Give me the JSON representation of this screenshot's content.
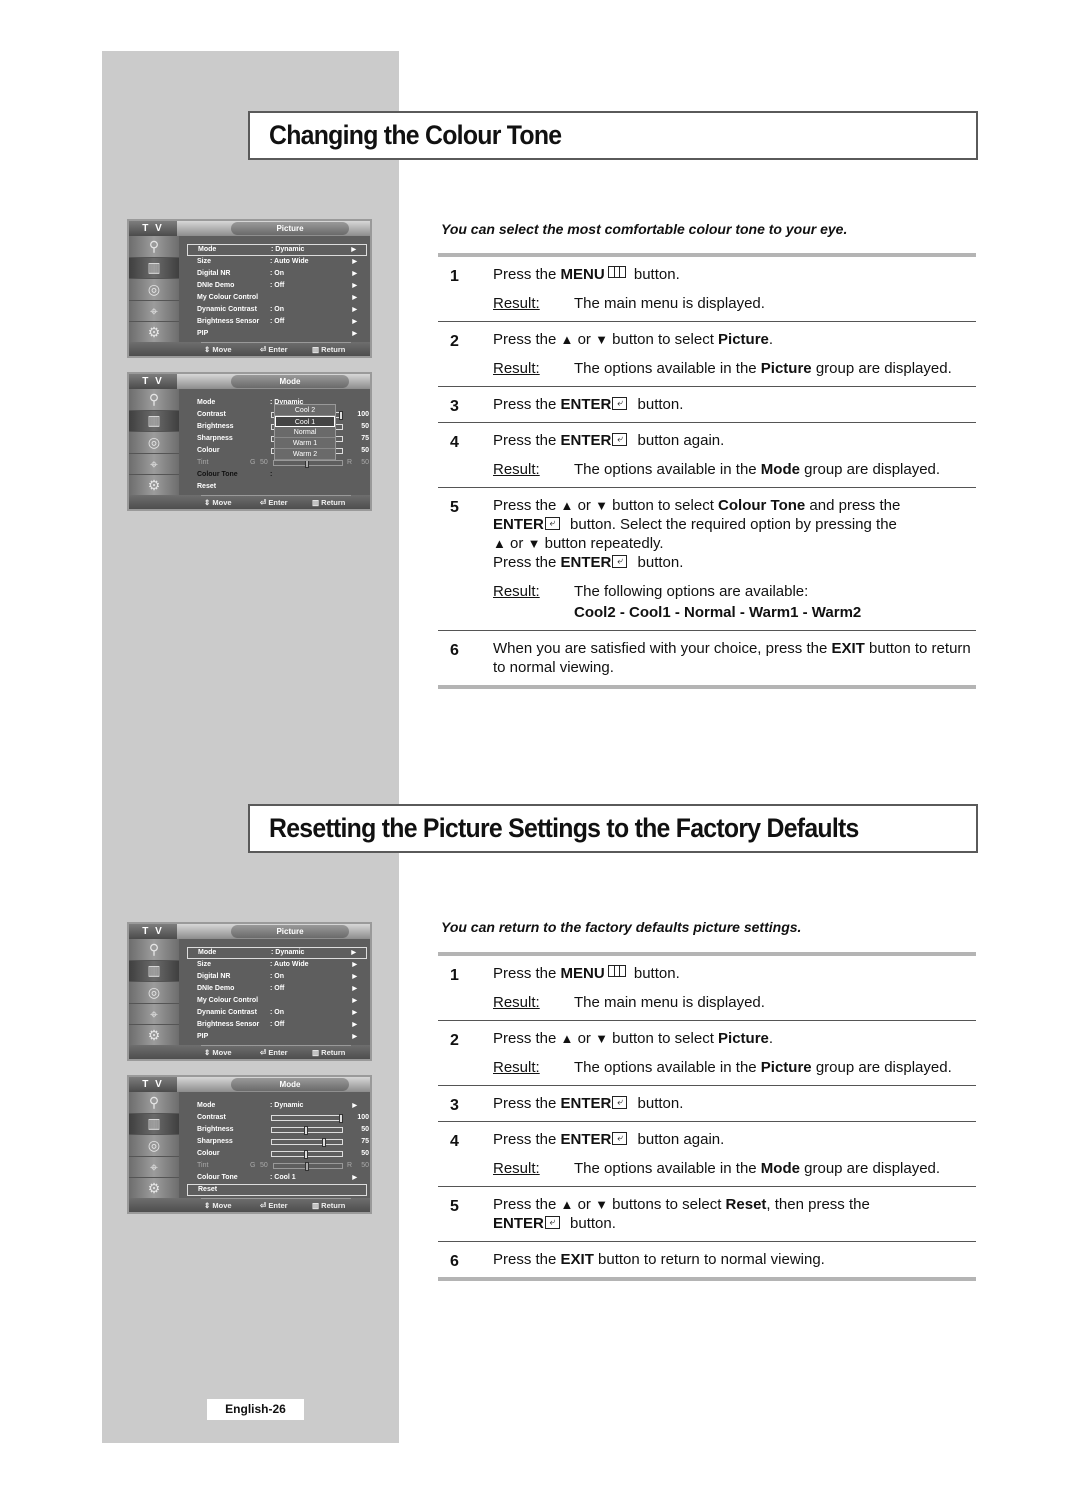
{
  "page": {
    "page_number": "English-26"
  },
  "common": {
    "result_label": "Result",
    "result_colon": ":"
  },
  "section1": {
    "title": "Changing the Colour Tone",
    "intro": "You can select the most comfortable colour tone to your eye.",
    "steps": [
      {
        "num": "1",
        "pre": "Press the ",
        "bold": "MENU",
        "icon": "menu-icon",
        "post": " button.",
        "result": "The main menu is displayed."
      },
      {
        "num": "2",
        "pre": "Press the ",
        "up": "▲",
        "mid": " or ",
        "down": "▼",
        "post": " button to select ",
        "bold": "Picture",
        "end": ".",
        "result_pre": "The options available in the ",
        "result_bold": "Picture",
        "result_post": " group are displayed."
      },
      {
        "num": "3",
        "pre": "Press the ",
        "bold": "ENTER",
        "icon": "enter-icon",
        "post": " button."
      },
      {
        "num": "4",
        "pre": "Press the ",
        "bold": "ENTER",
        "icon": "enter-icon",
        "post": " button again.",
        "result_pre": "The options available in the ",
        "result_bold": "Mode",
        "result_post": " group are displayed."
      },
      {
        "num": "5",
        "pre": "Press the ",
        "up": "▲",
        "mid": " or ",
        "down": "▼",
        "post": " button to select ",
        "bold": "Colour Tone",
        "post2": " and press the",
        "line2_bold": "ENTER",
        "line2_post": " button. Select the required option by pressing the",
        "line3_up": "▲",
        "line3_mid": " or ",
        "line3_down": "▼",
        "line3_post": " button repeatedly.",
        "line4_pre": "Press the ",
        "line4_bold": "ENTER",
        "line4_post": " button.",
        "result": "The following options are available:",
        "options": "Cool2 - Cool1 - Normal - Warm1 - Warm2"
      },
      {
        "num": "6",
        "pre": "When you are satisfied with your choice, press the ",
        "bold": "EXIT",
        "post": " button to return to normal viewing."
      }
    ]
  },
  "section2": {
    "title": "Resetting the Picture Settings to the Factory Defaults",
    "intro": "You can return to the factory defaults  picture settings.",
    "steps": [
      {
        "num": "1",
        "pre": "Press the ",
        "bold": "MENU",
        "post": " button.",
        "result": "The main menu is displayed."
      },
      {
        "num": "2",
        "pre": "Press the ",
        "up": "▲",
        "mid": " or ",
        "down": "▼",
        "post": " button to select ",
        "bold": "Picture",
        "end": ".",
        "result_pre": "The options available in the ",
        "result_bold": "Picture",
        "result_post": " group are displayed."
      },
      {
        "num": "3",
        "pre": "Press the ",
        "bold": "ENTER",
        "post": " button."
      },
      {
        "num": "4",
        "pre": "Press the ",
        "bold": "ENTER",
        "post": " button again.",
        "result_pre": "The options available in the ",
        "result_bold": "Mode",
        "result_post": " group are displayed."
      },
      {
        "num": "5",
        "pre": "Press the ",
        "up": "▲",
        "mid": " or ",
        "down": "▼",
        "post": " buttons to select ",
        "bold": "Reset",
        "post2": ", then press the",
        "line2_bold": "ENTER",
        "line2_post": " button."
      },
      {
        "num": "6",
        "pre": "Press the ",
        "bold": "EXIT",
        "post": " button to return to normal viewing."
      }
    ]
  },
  "osd": {
    "tv_label": "T V",
    "footer": {
      "move": "Move",
      "enter": "Enter",
      "return": "Return"
    },
    "picture_menu": {
      "title": "Picture",
      "rows": [
        {
          "label": "Mode",
          "value": ": Dynamic"
        },
        {
          "label": "Size",
          "value": ": Auto Wide"
        },
        {
          "label": "Digital NR",
          "value": ": On"
        },
        {
          "label": "DNIe Demo",
          "value": ": Off"
        },
        {
          "label": "My Colour Control",
          "value": ""
        },
        {
          "label": "Dynamic Contrast",
          "value": ": On"
        },
        {
          "label": "Brightness Sensor",
          "value": ": Off"
        },
        {
          "label": "PIP",
          "value": ""
        }
      ]
    },
    "mode_menu": {
      "title": "Mode",
      "mode_label": "Mode",
      "mode_value": ": Dynamic",
      "contrast_label": "Contrast",
      "contrast": 100,
      "brightness_label": "Brightness",
      "brightness": 50,
      "sharpness_label": "Sharpness",
      "sharpness": 75,
      "colour_label": "Colour",
      "colour": 50,
      "tint_label": "Tint",
      "tint_g_label": "G",
      "tint_g": "50",
      "tint_r_label": "R",
      "tint_r": "50",
      "tone_label": "Colour Tone",
      "tone_value": ": Cool 1",
      "reset_label": "Reset"
    },
    "tone_popup": {
      "options": [
        "Cool 2",
        "Cool 1",
        "Normal",
        "Warm 1",
        "Warm 2"
      ],
      "selected": "Cool 1"
    }
  }
}
